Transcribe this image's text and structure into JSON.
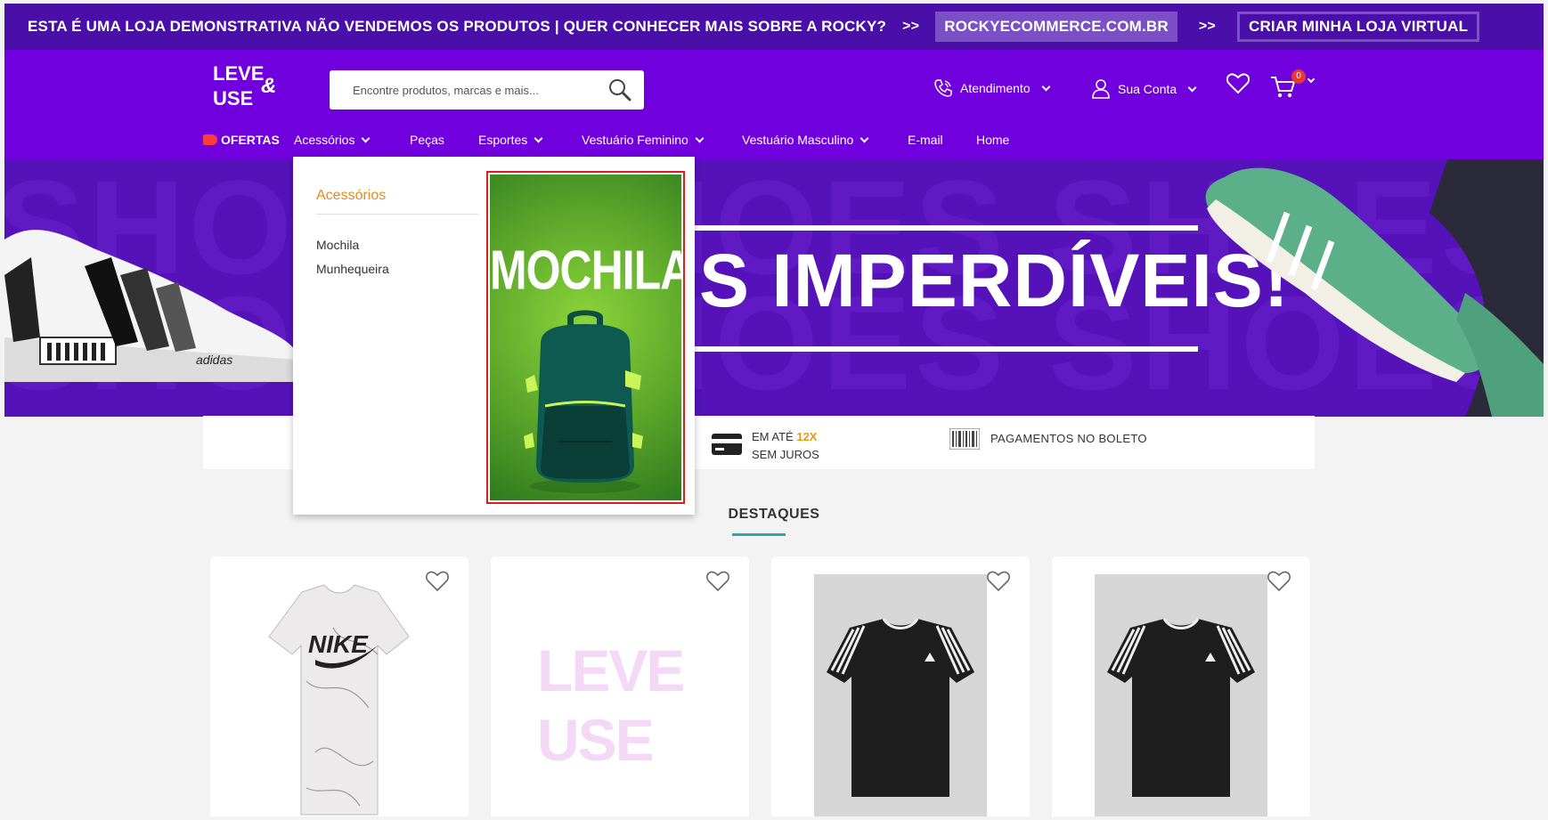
{
  "promo_bar": {
    "message": "ESTA É UMA LOJA DEMONSTRATIVA NÃO VENDEMOS OS PRODUTOS | QUER CONHECER MAIS SOBRE A ROCKY?",
    "arrows": ">>",
    "site_link": "ROCKYECOMMERCE.COM.BR",
    "cta": "CRIAR MINHA LOJA VIRTUAL"
  },
  "header": {
    "logo": {
      "line1": "LEVE",
      "amp": "&",
      "line2": "USE"
    },
    "search": {
      "placeholder": "Encontre produtos, marcas e mais..."
    },
    "atendimento": "Atendimento",
    "account": "Sua Conta",
    "cart_count": "0"
  },
  "nav": {
    "ofertas": "OFERTAS",
    "items": [
      "Acessórios",
      "Peças",
      "Esportes",
      "Vestuário Feminino",
      "Vestuário Masculino",
      "E-mail",
      "Home"
    ]
  },
  "banner": {
    "headline": "S IMPERDÍVEIS!",
    "bg_word": "SHOES SHOES SHOES",
    "brand_on_shoe": "adidas"
  },
  "info_strip": {
    "installments_prefix": "EM ATÉ",
    "installments_highlight": "12X",
    "installments_suffix": "SEM JUROS",
    "boleto": "PAGAMENTOS NO BOLETO"
  },
  "section": {
    "title": "DESTAQUES"
  },
  "products": [
    {
      "image": "nike-marble-tshirt"
    },
    {
      "image": "leve-use-placeholder",
      "logo_line1": "LEVE",
      "logo_line2": "USE"
    },
    {
      "image": "adidas-black-tshirt"
    },
    {
      "image": "adidas-black-tshirt"
    }
  ],
  "dropdown": {
    "title": "Acessórios",
    "items": [
      "Mochila",
      "Munhequeira"
    ],
    "promo_title": "MOCHILAS"
  },
  "colors": {
    "promo_bar": "#4a0fa8",
    "header": "#7000de",
    "banner": "#5412b8",
    "accent_orange": "#e98a1c",
    "section_underline": "#2ca7b4",
    "cart_badge": "#e53935"
  }
}
